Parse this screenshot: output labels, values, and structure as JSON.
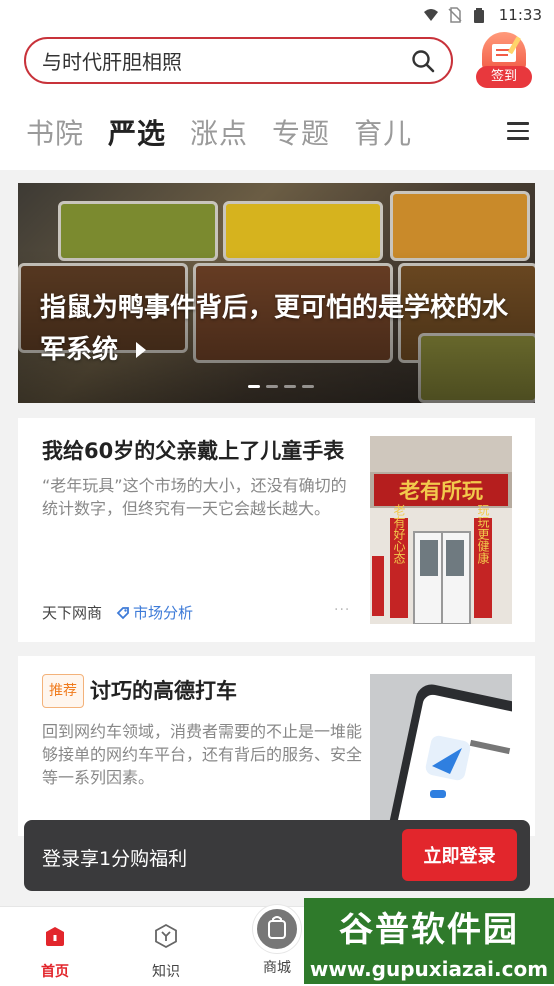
{
  "status_bar": {
    "time": "11:33"
  },
  "header": {
    "search_placeholder": "与时代肝胆相照",
    "signin_label": "签到",
    "tabs": [
      {
        "label": "书院",
        "active": false
      },
      {
        "label": "严选",
        "active": true
      },
      {
        "label": "涨点",
        "active": false
      },
      {
        "label": "专题",
        "active": false
      },
      {
        "label": "育儿",
        "active": false
      }
    ]
  },
  "banner": {
    "title": "指鼠为鸭事件背后，更可怕的是学校的水军系统",
    "dots": 4,
    "active_dot": 0
  },
  "articles": [
    {
      "title": "我给60岁的父亲戴上了儿童手表",
      "desc": "“老年玩具”这个市场的大小，还没有确切的统计数字，但终究有一天它会越长越大。",
      "source": "天下网商",
      "tag": "市场分析",
      "thumb_sign": "老有所玩",
      "thumb_couplet_left": "老有好心态",
      "thumb_couplet_right": "玩玩更健康"
    },
    {
      "badge": "推荐",
      "title": "讨巧的高德打车",
      "desc": "回到网约车领域，消费者需要的不止是一堆能够接单的网约车平台，还有背后的服务、安全等一系列因素。"
    }
  ],
  "login_bar": {
    "text": "登录享1分购福利",
    "button": "立即登录"
  },
  "bottom_nav": [
    {
      "label": "首页",
      "active": true
    },
    {
      "label": "知识",
      "active": false
    },
    {
      "label": "商城",
      "active": false
    }
  ],
  "watermark": {
    "title": "谷普软件园",
    "url": "www.gupuxiazai.com"
  },
  "colors": {
    "brand_red": "#e2262c",
    "link_blue": "#3e7bd8",
    "badge_orange": "#f07b1d"
  }
}
